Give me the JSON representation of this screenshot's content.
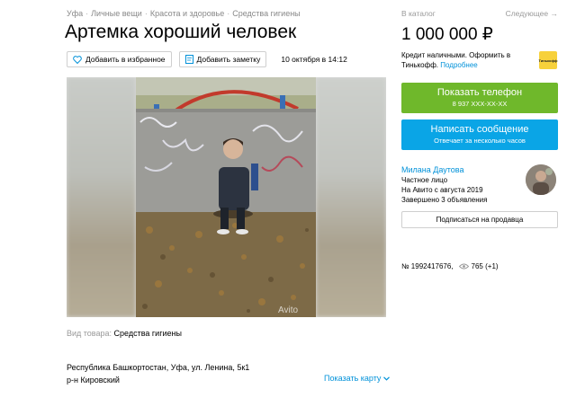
{
  "breadcrumbs": [
    "Уфа",
    "Личные вещи",
    "Красота и здоровье",
    "Средства гигиены"
  ],
  "title": "Артемка хороший человек",
  "actions": {
    "favorite_label": "Добавить в избранное",
    "note_label": "Добавить заметку",
    "date": "10 октября в 14:12"
  },
  "photo": {
    "watermark": "Avito"
  },
  "params": {
    "type_key": "Вид товара:",
    "type_value": "Средства гигиены"
  },
  "address": {
    "line1": "Республика Башкортостан, Уфа, ул. Ленина, 5к1",
    "line2": "р-н Кировский",
    "map_link": "Показать карту"
  },
  "sidebar": {
    "catalog_link": "В каталог",
    "next_link": "Следующее →",
    "price": "1 000 000 ₽",
    "credit_text": "Кредит наличными. Оформить в Тинькофф.",
    "credit_more": "Подробнее",
    "tinkoff_label": "Тинькофф",
    "phone_button": "Показать телефон",
    "phone_masked": "8 937 XXX-XX-XX",
    "message_button": "Написать сообщение",
    "message_sub": "Отвечает за несколько часов",
    "seller": {
      "name": "Милана Даутова",
      "type": "Частное лицо",
      "since": "На Авито с августа 2019",
      "closed": "Завершено 3 объявления"
    },
    "subscribe_button": "Подписаться на продавца",
    "ad_number": "№ 1992417676,",
    "views": "765 (+1)"
  },
  "colors": {
    "link": "#0091d9",
    "green": "#6fb82b",
    "blue": "#0aa5e6",
    "tinkoff": "#f7d13b"
  }
}
